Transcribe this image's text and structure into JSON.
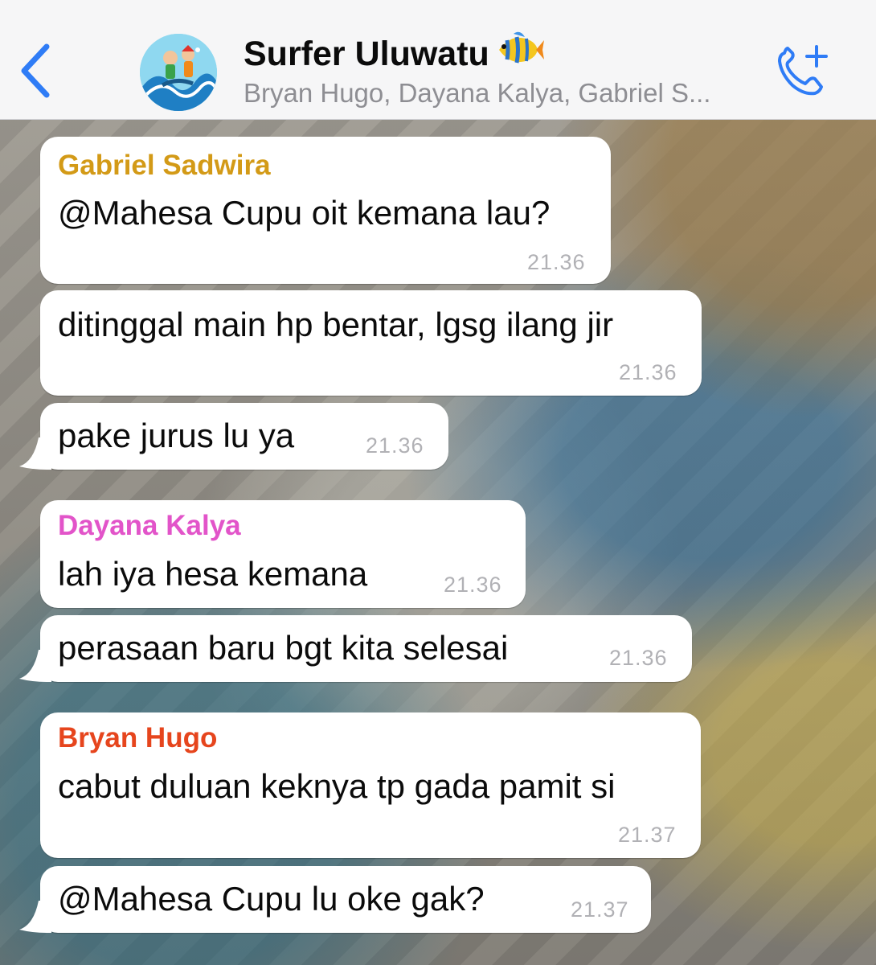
{
  "header": {
    "back_label": "Back",
    "title": "Surfer Uluwatu",
    "title_emoji_icon": "tropical-fish-icon",
    "subtitle": "Bryan Hugo, Dayana Kalya, Gabriel S...",
    "avatar_icon": "group-avatar",
    "call_icon": "add-call-icon",
    "accent_color": "#2f7cf6"
  },
  "messages": [
    {
      "sender": "Gabriel Sadwira",
      "sender_color": "#d39a17",
      "text": "@Mahesa Cupu oit kemana lau?",
      "time": "21.36"
    },
    {
      "sender": "",
      "text": "ditinggal main hp bentar, lgsg ilang jir",
      "time": "21.36"
    },
    {
      "sender": "",
      "text": "pake jurus lu ya",
      "time": "21.36"
    },
    {
      "sender": "Dayana Kalya",
      "sender_color": "#e254c9",
      "text": "lah iya hesa kemana",
      "time": "21.36"
    },
    {
      "sender": "",
      "text": "perasaan baru bgt kita selesai",
      "time": "21.36"
    },
    {
      "sender": "Bryan Hugo",
      "sender_color": "#e6451d",
      "text": "cabut duluan keknya tp gada pamit si",
      "time": "21.37"
    },
    {
      "sender": "",
      "text": "@Mahesa Cupu lu oke gak?",
      "time": "21.37"
    }
  ]
}
